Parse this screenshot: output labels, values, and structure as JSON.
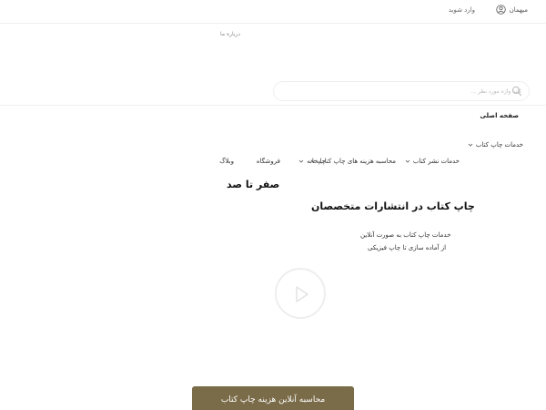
{
  "topbar": {
    "guest_label": "میهمان",
    "login_label": "وارد شوید",
    "user_icon": "user-circle-icon"
  },
  "nav": {
    "about_label": "درباره ما"
  },
  "search": {
    "placeholder": "کلید واژه مورد نظر ...",
    "icon": "search-icon"
  },
  "menu": {
    "home_label": "صفحه اصلی",
    "items": [
      {
        "label": "خدمات چاپ کتاب",
        "has_dropdown": true
      },
      {
        "label": "خدمات نشر کتاب",
        "has_dropdown": true
      },
      {
        "label": "محاسبه هزینه های چاپ کتاب",
        "has_dropdown": true
      },
      {
        "label": "چاپخانه",
        "has_dropdown": true
      },
      {
        "label": "فروشگاه",
        "has_dropdown": false
      },
      {
        "label": "وبلاگ",
        "has_dropdown": false
      }
    ]
  },
  "hero": {
    "slogan": "صفر تا صد",
    "headline": "چاپ کتاب در انتشارات متخصصان",
    "subtitle_line1": "خدمات چاپ کتاب به صورت آنلاین",
    "subtitle_line2": "از آماده سازی تا چاپ فیزیکی",
    "play_icon": "play-icon",
    "cta_label": "محاسبه آنلاین هزینه چاپ کتاب"
  },
  "colors": {
    "cta_background": "#7a6b49",
    "cta_text": "#ffffff",
    "border": "#eeeeee"
  }
}
